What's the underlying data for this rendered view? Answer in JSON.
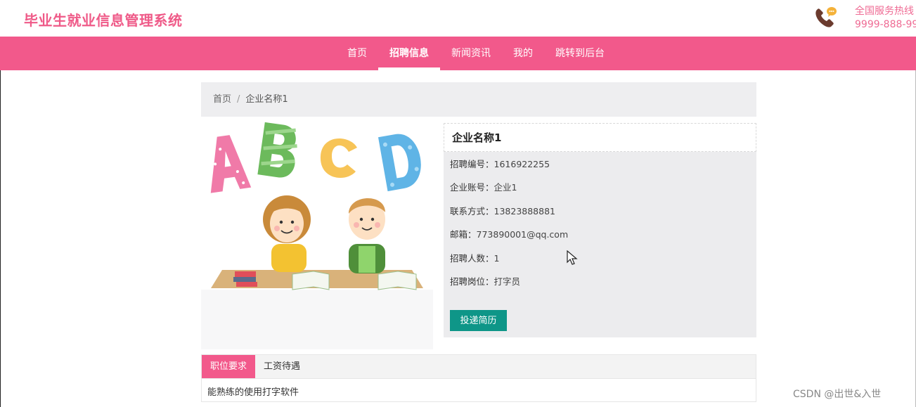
{
  "header": {
    "site_title": "毕业生就业信息管理系统",
    "hotline_label": "全国服务热线",
    "hotline_number": "9999-888-999"
  },
  "nav": {
    "items": [
      {
        "label": "首页",
        "active": false
      },
      {
        "label": "招聘信息",
        "active": true
      },
      {
        "label": "新闻资讯",
        "active": false
      },
      {
        "label": "我的",
        "active": false
      },
      {
        "label": "跳转到后台",
        "active": false
      }
    ]
  },
  "breadcrumb": {
    "home": "首页",
    "separator": "/",
    "current": "企业名称1"
  },
  "detail": {
    "company_name": "企业名称1",
    "fields": [
      {
        "label": "招聘编号：",
        "value": "1616922255"
      },
      {
        "label": "企业账号：",
        "value": "企业1"
      },
      {
        "label": "联系方式：",
        "value": "13823888881"
      },
      {
        "label": "邮箱：",
        "value": "773890001@qq.com"
      },
      {
        "label": "招聘人数：",
        "value": "1"
      },
      {
        "label": "招聘岗位：",
        "value": "打字员"
      }
    ],
    "apply_button": "投递简历",
    "image_letters": [
      "A",
      "B",
      "C",
      "D"
    ]
  },
  "tabs": {
    "items": [
      {
        "label": "职位要求",
        "active": true
      },
      {
        "label": "工资待遇",
        "active": false
      }
    ],
    "content": "能熟练的使用打字软件"
  },
  "watermark": "CSDN @出世&入世",
  "colors": {
    "brand_pink": "#f2598b",
    "title_pink": "#ef5a88",
    "button_teal": "#0e9688",
    "panel_gray": "#ececee"
  },
  "icons": {
    "hotline": "phone-chat-icon",
    "cursor": "mouse-pointer-icon"
  }
}
